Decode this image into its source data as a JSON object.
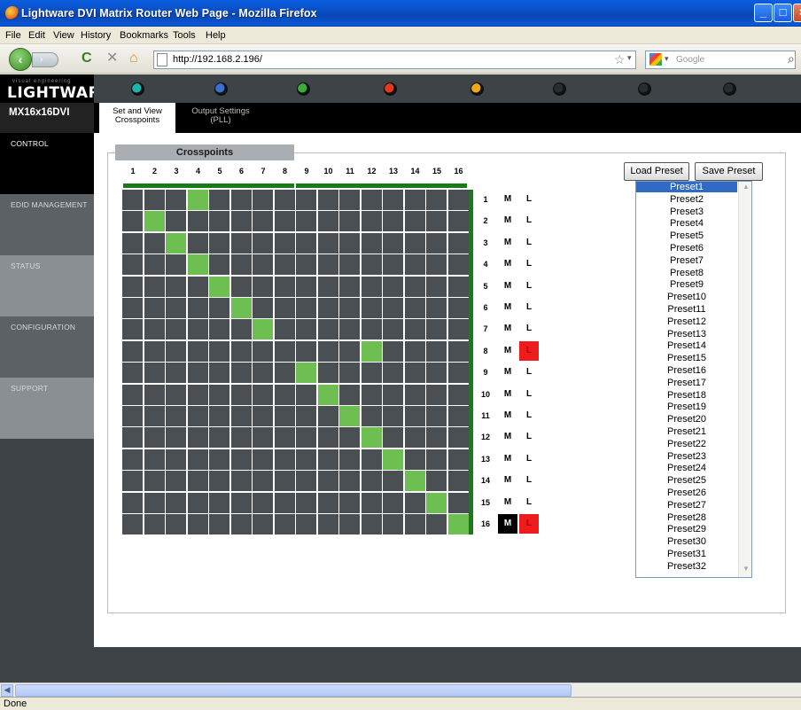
{
  "window": {
    "title": "Lightware DVI Matrix Router Web Page - Mozilla Firefox"
  },
  "menu": [
    "File",
    "Edit",
    "View",
    "History",
    "Bookmarks",
    "Tools",
    "Help"
  ],
  "navbar": {
    "url": "http://192.168.2.196/",
    "search_placeholder": "Google"
  },
  "brand": {
    "tagline": "visual engineering",
    "logo": "LIGHTWARE"
  },
  "leds": [
    {
      "color": "#1fb5a8"
    },
    {
      "color": "#3a6fd0"
    },
    {
      "color": "#3cab3c"
    },
    {
      "color": "#e43a1a"
    },
    {
      "color": "#f0a818"
    },
    {
      "color": "#2a2d30"
    },
    {
      "color": "#2a2d30"
    },
    {
      "color": "#2a2d30"
    }
  ],
  "device": {
    "name": "MX16x16DVI"
  },
  "tabs": [
    {
      "label": "Set and View Crosspoints"
    },
    {
      "label": "Output Settings (PLL)"
    }
  ],
  "sidebar": [
    {
      "label": "CONTROL"
    },
    {
      "label": "EDID MANAGEMENT"
    },
    {
      "label": "STATUS"
    },
    {
      "label": "CONFIGURATION"
    },
    {
      "label": "SUPPORT"
    }
  ],
  "crosspoints": {
    "header": "Crosspoints",
    "inputs": [
      "1",
      "2",
      "3",
      "4",
      "5",
      "6",
      "7",
      "8",
      "9",
      "10",
      "11",
      "12",
      "13",
      "14",
      "15",
      "16"
    ],
    "outputs": [
      {
        "label": "1",
        "input": 4,
        "mute": "M",
        "lock": "L",
        "muted": false,
        "locked": false
      },
      {
        "label": "2",
        "input": 2,
        "mute": "M",
        "lock": "L",
        "muted": false,
        "locked": false
      },
      {
        "label": "3",
        "input": 3,
        "mute": "M",
        "lock": "L",
        "muted": false,
        "locked": false
      },
      {
        "label": "4",
        "input": 4,
        "mute": "M",
        "lock": "L",
        "muted": false,
        "locked": false
      },
      {
        "label": "5",
        "input": 5,
        "mute": "M",
        "lock": "L",
        "muted": false,
        "locked": false
      },
      {
        "label": "6",
        "input": 6,
        "mute": "M",
        "lock": "L",
        "muted": false,
        "locked": false
      },
      {
        "label": "7",
        "input": 7,
        "mute": "M",
        "lock": "L",
        "muted": false,
        "locked": false
      },
      {
        "label": "8",
        "input": 12,
        "mute": "M",
        "lock": "L",
        "muted": false,
        "locked": true
      },
      {
        "label": "9",
        "input": 9,
        "mute": "M",
        "lock": "L",
        "muted": false,
        "locked": false
      },
      {
        "label": "10",
        "input": 10,
        "mute": "M",
        "lock": "L",
        "muted": false,
        "locked": false
      },
      {
        "label": "11",
        "input": 11,
        "mute": "M",
        "lock": "L",
        "muted": false,
        "locked": false
      },
      {
        "label": "12",
        "input": 12,
        "mute": "M",
        "lock": "L",
        "muted": false,
        "locked": false
      },
      {
        "label": "13",
        "input": 13,
        "mute": "M",
        "lock": "L",
        "muted": false,
        "locked": false
      },
      {
        "label": "14",
        "input": 14,
        "mute": "M",
        "lock": "L",
        "muted": false,
        "locked": false
      },
      {
        "label": "15",
        "input": 15,
        "mute": "M",
        "lock": "L",
        "muted": false,
        "locked": false
      },
      {
        "label": "16",
        "input": 16,
        "mute": "M",
        "lock": "L",
        "muted": true,
        "locked": true
      }
    ]
  },
  "presets": {
    "load_label": "Load Preset",
    "save_label": "Save Preset",
    "selected": "Preset1",
    "items": [
      "Preset1",
      "Preset2",
      "Preset3",
      "Preset4",
      "Preset5",
      "Preset6",
      "Preset7",
      "Preset8",
      "Preset9",
      "Preset10",
      "Preset11",
      "Preset12",
      "Preset13",
      "Preset14",
      "Preset15",
      "Preset16",
      "Preset17",
      "Preset18",
      "Preset19",
      "Preset20",
      "Preset21",
      "Preset22",
      "Preset23",
      "Preset24",
      "Preset25",
      "Preset26",
      "Preset27",
      "Preset28",
      "Preset29",
      "Preset30",
      "Preset31",
      "Preset32"
    ]
  },
  "status": {
    "text": "Done"
  }
}
